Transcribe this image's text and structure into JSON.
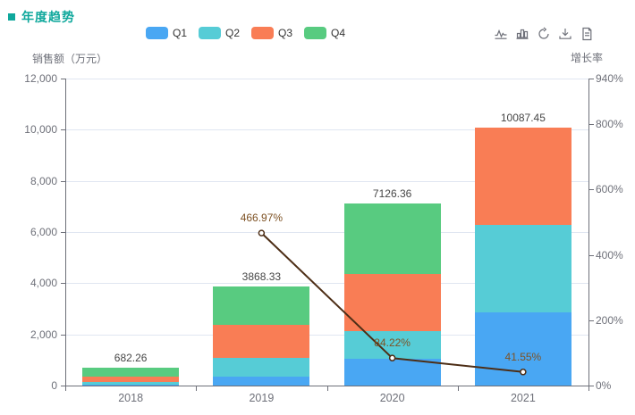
{
  "header": {
    "title": "年度趋势",
    "accent_color": "#0fa89c"
  },
  "legend": {
    "items": [
      {
        "label": "Q1",
        "color": "#49a7f3"
      },
      {
        "label": "Q2",
        "color": "#56ccd6"
      },
      {
        "label": "Q3",
        "color": "#f97d55"
      },
      {
        "label": "Q4",
        "color": "#58cb80"
      }
    ]
  },
  "toolbar": {
    "icon_color": "#6e7079",
    "icons": [
      "line-chart",
      "bar-chart",
      "restore",
      "download",
      "data-view"
    ]
  },
  "axes": {
    "left": {
      "name": "销售额（万元）",
      "ticks": [
        {
          "value": 0,
          "label": "0"
        },
        {
          "value": 2000,
          "label": "2,000"
        },
        {
          "value": 4000,
          "label": "4,000"
        },
        {
          "value": 6000,
          "label": "6,000"
        },
        {
          "value": 8000,
          "label": "8,000"
        },
        {
          "value": 10000,
          "label": "10,000"
        },
        {
          "value": 12000,
          "label": "12,000"
        }
      ],
      "max": 12000
    },
    "right": {
      "name": "增长率",
      "ticks": [
        {
          "value": 0,
          "label": "0%"
        },
        {
          "value": 200,
          "label": "200%"
        },
        {
          "value": 400,
          "label": "400%"
        },
        {
          "value": 600,
          "label": "600%"
        },
        {
          "value": 800,
          "label": "800%"
        },
        {
          "value": 940,
          "label": "940%"
        }
      ],
      "max": 940
    },
    "x": {
      "categories": [
        "2018",
        "2019",
        "2020",
        "2021"
      ]
    }
  },
  "colors": {
    "grid": "#e0e6f1",
    "axis": "#6e7079",
    "bar_total_label": "#464646",
    "line": "#4d2e16",
    "line_label": "#7e5224"
  },
  "chart_data": [
    {
      "type": "bar",
      "stacked": true,
      "title": "年度趋势",
      "categories": [
        "2018",
        "2019",
        "2020",
        "2021"
      ],
      "series": [
        {
          "name": "Q1",
          "color": "#49a7f3",
          "values": [
            35,
            350,
            1043,
            2856
          ]
        },
        {
          "name": "Q2",
          "color": "#56ccd6",
          "values": [
            110,
            725,
            1092,
            3407
          ]
        },
        {
          "name": "Q3",
          "color": "#f97d55",
          "values": [
            200,
            1280,
            2238,
            3824.45
          ]
        },
        {
          "name": "Q4",
          "color": "#58cb80",
          "values": [
            337.26,
            1513.33,
            2753.36,
            0
          ]
        }
      ],
      "totals": [
        682.26,
        3868.33,
        7126.36,
        10087.45
      ],
      "total_labels": [
        "682.26",
        "3868.33",
        "7126.36",
        "10087.45"
      ],
      "ylabel": "销售额（万元）",
      "ylim": [
        0,
        12000
      ],
      "yticks": [
        0,
        2000,
        4000,
        6000,
        8000,
        10000,
        12000
      ],
      "grid": true,
      "legend_position": "top"
    },
    {
      "type": "line",
      "name": "增长率",
      "x": [
        "2019",
        "2020",
        "2021"
      ],
      "values": [
        466.97,
        84.22,
        41.55
      ],
      "labels": [
        "466.97%",
        "84.22%",
        "41.55%"
      ],
      "color": "#4d2e16",
      "label_color": "#7e5224",
      "axis": "right",
      "ylim": [
        0,
        940
      ],
      "yticks": [
        0,
        200,
        400,
        600,
        800,
        940
      ]
    }
  ]
}
